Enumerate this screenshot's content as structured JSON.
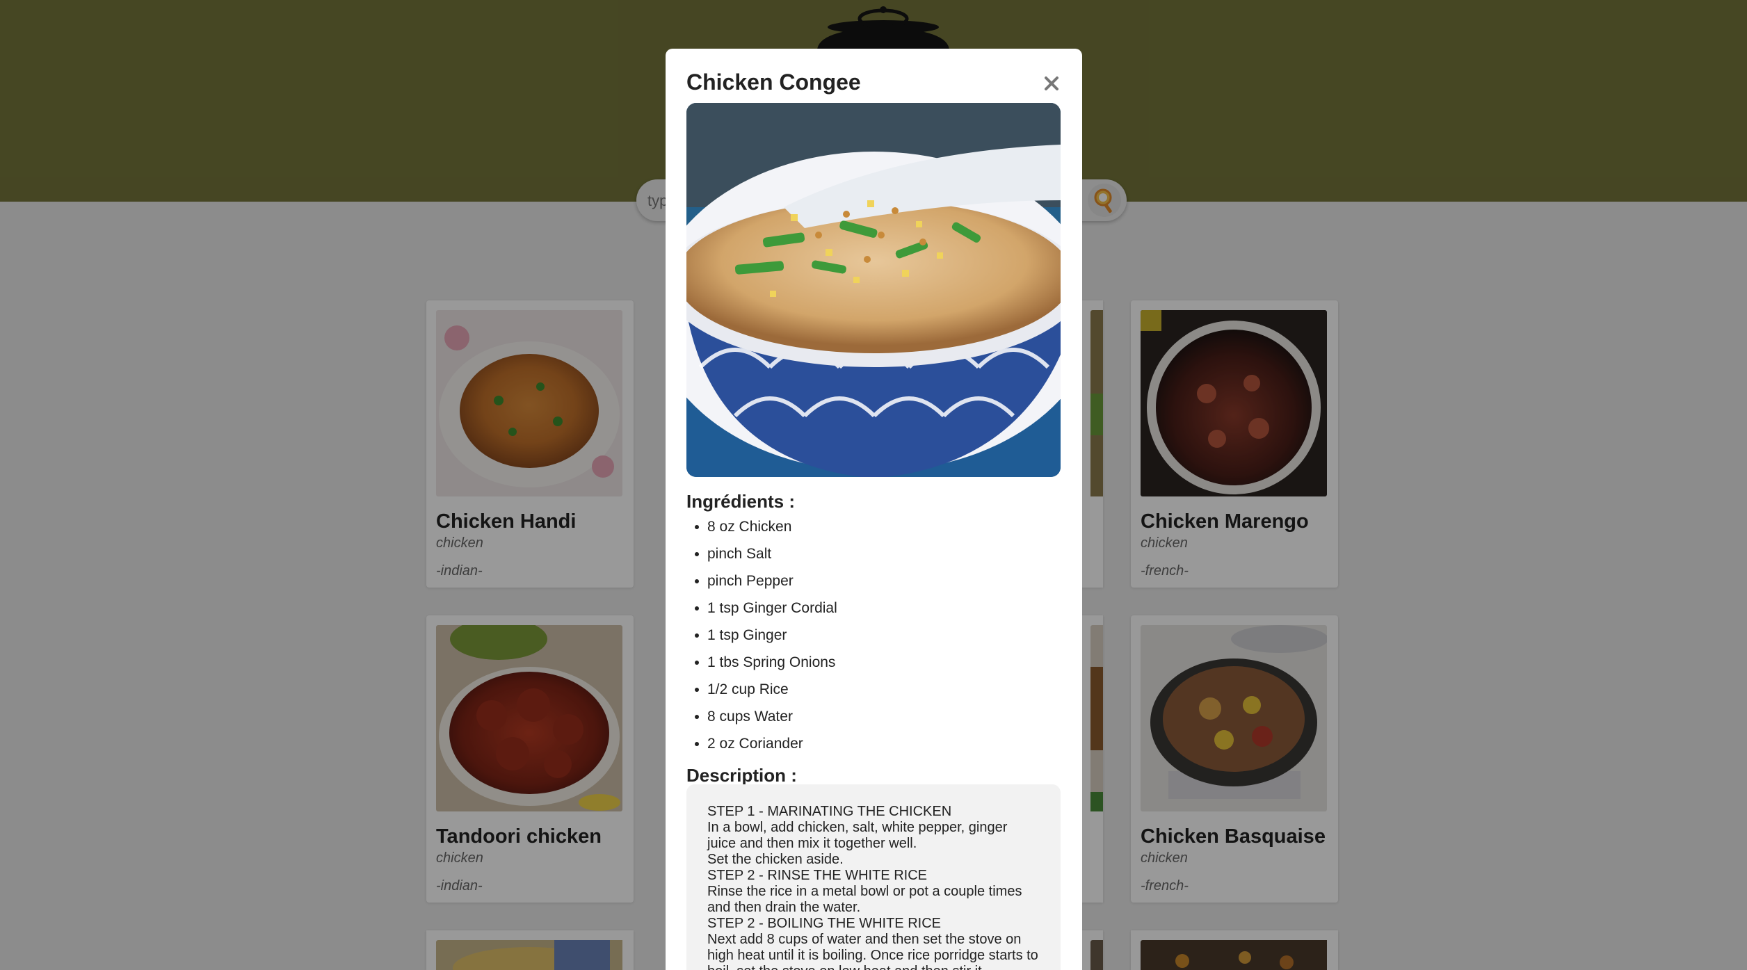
{
  "search": {
    "placeholder": "type a meal..."
  },
  "cards": [
    {
      "title": "Chicken Handi",
      "category": "chicken",
      "area": "-indian-"
    },
    {
      "title": "Chicken Marengo",
      "category": "chicken",
      "area": "-french-"
    },
    {
      "title": "Tandoori chicken",
      "category": "chicken",
      "area": "-indian-"
    },
    {
      "title": "Chicken Basquaise",
      "category": "chicken",
      "area": "-french-"
    }
  ],
  "modal": {
    "title": "Chicken Congee",
    "ingredients_heading": "Ingrédients :",
    "ingredients": [
      "8 oz Chicken",
      "pinch Salt",
      "pinch Pepper",
      "1 tsp Ginger Cordial",
      "1 tsp Ginger",
      "1 tbs Spring Onions",
      "1/2 cup Rice",
      "8 cups Water",
      "2 oz Coriander"
    ],
    "description_heading": "Description :",
    "description": "STEP 1 - MARINATING THE CHICKEN\nIn a bowl, add chicken, salt, white pepper, ginger juice and then mix it together well.\nSet the chicken aside.\nSTEP 2 - RINSE THE WHITE RICE\nRinse the rice in a metal bowl or pot a couple times and then drain the water.\nSTEP 2 - BOILING THE WHITE RICE\nNext add 8 cups of water and then set the stove on high heat until it is boiling. Once rice porridge starts to boil, set the stove on low heat and then stir it"
  },
  "colors": {
    "hero": "#75763b",
    "background": "#eaeaea",
    "overlay": "rgba(0,0,0,0.4)"
  },
  "icons": {
    "close": "close-icon",
    "search": "search-icon",
    "logo": "cooking-pot-logo"
  }
}
